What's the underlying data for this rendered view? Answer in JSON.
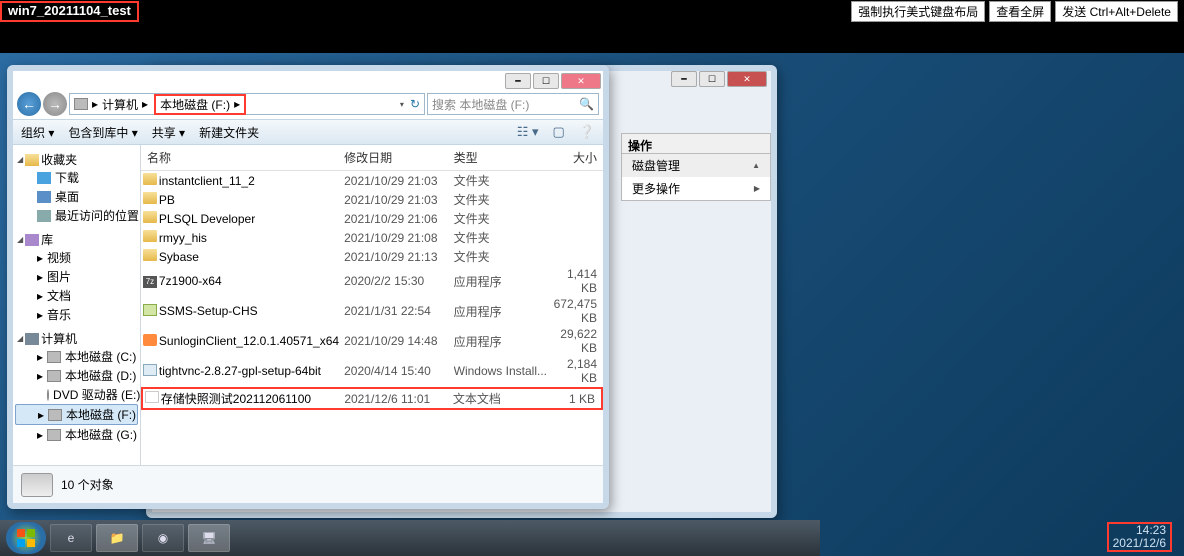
{
  "viewer": {
    "vm_name": "win7_20211104_test",
    "buttons": {
      "force_kb": "强制执行美式键盘布局",
      "fullscreen": "查看全屏",
      "cad": "发送 Ctrl+Alt+Delete"
    }
  },
  "back_window": {
    "actions_title": "操作",
    "disk_mgmt": "磁盘管理",
    "more_actions": "更多操作"
  },
  "explorer": {
    "breadcrumb": {
      "computer": "计算机",
      "drive": "本地磁盘 (F:)"
    },
    "search_placeholder": "搜索 本地磁盘 (F:)",
    "toolbar": {
      "organize": "组织 ▾",
      "include": "包含到库中 ▾",
      "share": "共享 ▾",
      "newfolder": "新建文件夹"
    },
    "sidebar": {
      "favorites": "收藏夹",
      "fav_items": {
        "downloads": "下载",
        "desktop": "桌面",
        "recent": "最近访问的位置"
      },
      "libraries": "库",
      "lib_items": {
        "videos": "视频",
        "pictures": "图片",
        "documents": "文档",
        "music": "音乐"
      },
      "computer": "计算机",
      "drives": {
        "c": "本地磁盘 (C:)",
        "d": "本地磁盘 (D:)",
        "e": "DVD 驱动器 (E:)",
        "f": "本地磁盘 (F:)",
        "g": "本地磁盘 (G:)"
      }
    },
    "columns": {
      "name": "名称",
      "date": "修改日期",
      "type": "类型",
      "size": "大小"
    },
    "files": [
      {
        "icon": "folder",
        "name": "instantclient_11_2",
        "date": "2021/10/29 21:03",
        "type": "文件夹",
        "size": ""
      },
      {
        "icon": "folder",
        "name": "PB",
        "date": "2021/10/29 21:03",
        "type": "文件夹",
        "size": ""
      },
      {
        "icon": "folder",
        "name": "PLSQL Developer",
        "date": "2021/10/29 21:06",
        "type": "文件夹",
        "size": ""
      },
      {
        "icon": "folder",
        "name": "rmyy_his",
        "date": "2021/10/29 21:08",
        "type": "文件夹",
        "size": ""
      },
      {
        "icon": "folder",
        "name": "Sybase",
        "date": "2021/10/29 21:13",
        "type": "文件夹",
        "size": ""
      },
      {
        "icon": "7z",
        "name": "7z1900-x64",
        "date": "2020/2/2 15:30",
        "type": "应用程序",
        "size": "1,414 KB"
      },
      {
        "icon": "exe",
        "name": "SSMS-Setup-CHS",
        "date": "2021/1/31 22:54",
        "type": "应用程序",
        "size": "672,475 KB"
      },
      {
        "icon": "sun",
        "name": "SunloginClient_12.0.1.40571_x64",
        "date": "2021/10/29 14:48",
        "type": "应用程序",
        "size": "29,622 KB"
      },
      {
        "icon": "msi",
        "name": "tightvnc-2.8.27-gpl-setup-64bit",
        "date": "2020/4/14 15:40",
        "type": "Windows Install...",
        "size": "2,184 KB"
      },
      {
        "icon": "txt",
        "name": "存储快照测试202112061100",
        "date": "2021/12/6 11:01",
        "type": "文本文档",
        "size": "1 KB",
        "highlight": true
      }
    ],
    "status": "10 个对象"
  },
  "tray": {
    "time": "14:23",
    "date": "2021/12/6"
  }
}
